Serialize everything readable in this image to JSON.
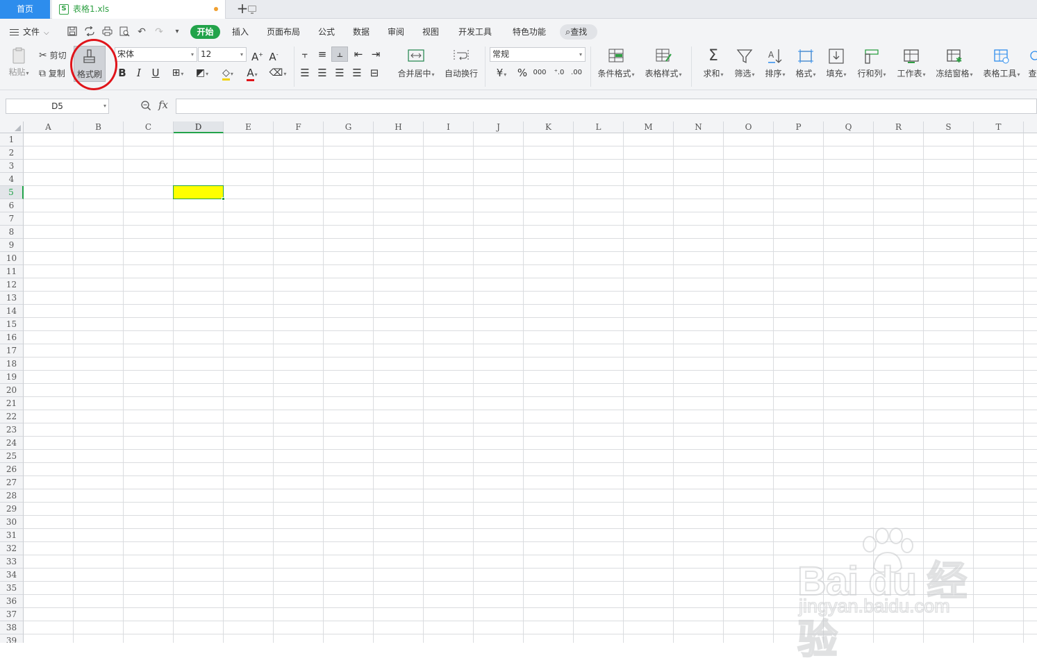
{
  "tabs": {
    "home": "首页",
    "file": "表格1.xls",
    "file_icon": "S",
    "add": "+"
  },
  "menu": {
    "file": "文件",
    "ribbon_tabs": [
      "开始",
      "插入",
      "页面布局",
      "公式",
      "数据",
      "审阅",
      "视图",
      "开发工具",
      "特色功能"
    ],
    "search": "查找"
  },
  "ribbon": {
    "paste": "粘贴",
    "cut": "剪切",
    "copy": "复制",
    "format_painter": "格式刷",
    "font_name": "宋体",
    "font_size": "12",
    "number_format": "常规",
    "merge_center": "合并居中",
    "wrap_text": "自动换行",
    "currency_symbol": "¥",
    "percent_symbol": "%",
    "thousands_symbol": "000",
    "cond_format": "条件格式",
    "table_style": "表格样式",
    "sum": "求和",
    "filter": "筛选",
    "sort": "排序",
    "format": "格式",
    "fill": "填充",
    "row_col": "行和列",
    "worksheet": "工作表",
    "freeze": "冻结窗格",
    "table_tools": "表格工具",
    "query_partial": "查"
  },
  "formula_bar": {
    "cell_ref": "D5",
    "fx": "fx",
    "formula": ""
  },
  "sheet": {
    "columns": [
      "A",
      "B",
      "C",
      "D",
      "E",
      "F",
      "G",
      "H",
      "I",
      "J",
      "K",
      "L",
      "M",
      "N",
      "O",
      "P",
      "Q",
      "R",
      "S",
      "T"
    ],
    "rows": [
      "1",
      "2",
      "3",
      "4",
      "5",
      "6",
      "7",
      "8",
      "9",
      "10",
      "11",
      "12",
      "13",
      "14",
      "15",
      "16",
      "17",
      "18",
      "19",
      "20",
      "21",
      "22",
      "23",
      "24",
      "25",
      "26",
      "27",
      "28",
      "29",
      "30",
      "31",
      "32",
      "33",
      "34",
      "35",
      "36",
      "37",
      "38",
      "39"
    ],
    "active_column": "D",
    "active_row": "5",
    "selected_cell_fill": "#ffff00"
  },
  "colors": {
    "accent_green": "#22a34a",
    "home_tab_blue": "#2d8ded",
    "annotation_red": "#e0141a"
  },
  "watermark": {
    "brand": "Bai du 经验",
    "url": "jingyan.baidu.com"
  }
}
